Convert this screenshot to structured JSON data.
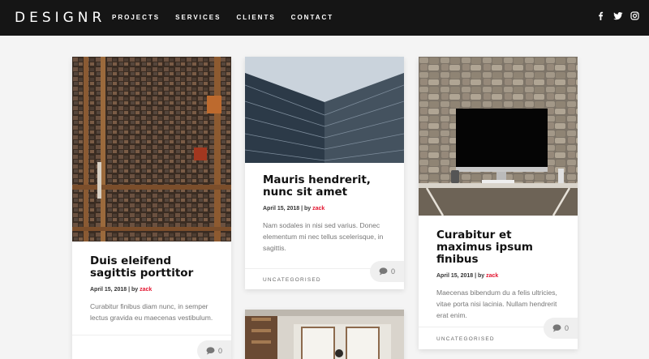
{
  "site": {
    "logo": "DESIGNR"
  },
  "nav": {
    "items": [
      "PROJECTS",
      "SERVICES",
      "CLIENTS",
      "CONTACT"
    ]
  },
  "social": [
    "facebook-icon",
    "twitter-icon",
    "instagram-icon"
  ],
  "posts": [
    {
      "title": "Duis eleifend sagittis porttitor",
      "date": "April 15, 2018",
      "sep": " | by ",
      "author": "zack",
      "excerpt": "Curabitur finibus diam nunc, in semper lectus gravida eu maecenas vestibulum.",
      "comments": "0"
    },
    {
      "title": "Mauris hendrerit, nunc sit amet",
      "date": "April 15, 2018",
      "sep": " | by ",
      "author": "zack",
      "excerpt": "Nam sodales in nisi sed varius. Donec elementum mi nec tellus scelerisque, in sagittis.",
      "category": "UNCATEGORISED",
      "comments": "0"
    },
    {
      "title": "Curabitur et maximus ipsum finibus",
      "date": "April 15, 2018",
      "sep": " | by ",
      "author": "zack",
      "excerpt": "Maecenas bibendum du a felis ultricies, vitae porta nisi lacinia. Nullam hendrerit erat enim.",
      "category": "UNCATEGORISED",
      "comments": "0"
    }
  ],
  "colors": {
    "topbar": "#151515",
    "accent": "#e3142f"
  }
}
